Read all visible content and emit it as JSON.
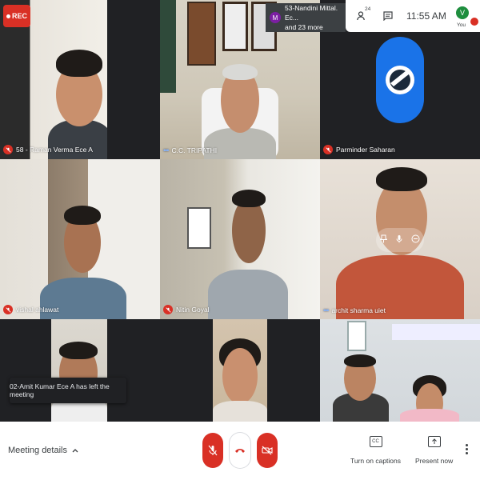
{
  "recording": {
    "label": "REC"
  },
  "participants_pill": {
    "avatar_letter": "M",
    "line1": "53-Nandini Mittal. Ec...",
    "line2": "and 23 more"
  },
  "topbar": {
    "people_count": "24",
    "time": "11:55 AM",
    "you_avatar": "V",
    "you_label": "You"
  },
  "tiles": [
    {
      "name": "58 - Raman Verma Ece A",
      "muted": true
    },
    {
      "name": "C.C. TRIPATHI",
      "muted": false
    },
    {
      "name": "Parminder Saharan",
      "muted": true
    },
    {
      "name": "vishal ahlawat",
      "muted": true
    },
    {
      "name": "Nitin Goyal",
      "muted": true
    },
    {
      "name": "archit sharma uiet",
      "muted": false
    },
    {
      "name": "",
      "muted": false
    },
    {
      "name": "",
      "muted": false
    },
    {
      "name": "",
      "muted": false
    }
  ],
  "toast": {
    "text": "02-Amit Kumar Ece A has left the meeting"
  },
  "bottom": {
    "meeting_details": "Meeting details",
    "captions_label": "Turn on captions",
    "captions_icon": "CC",
    "present_label": "Present now"
  },
  "colors": {
    "danger": "#d93025",
    "accent": "#1a73e8",
    "bar_bg": "#ffffff",
    "tile_bg": "#3c4043"
  }
}
